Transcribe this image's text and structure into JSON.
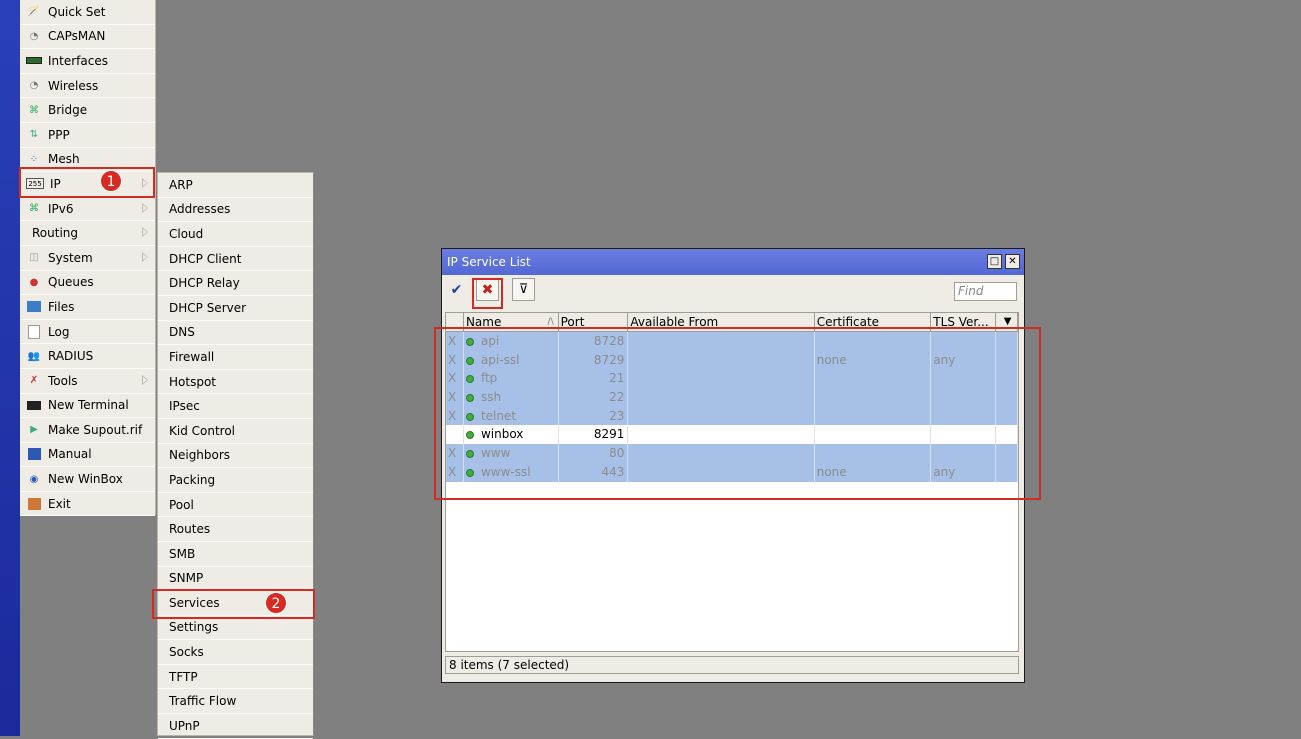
{
  "main_menu": [
    {
      "label": "Quick Set",
      "icon": "wand-icon",
      "submenu": false
    },
    {
      "label": "CAPsMAN",
      "icon": "antenna-icon",
      "submenu": false
    },
    {
      "label": "Interfaces",
      "icon": "interfaces-icon",
      "submenu": false
    },
    {
      "label": "Wireless",
      "icon": "wireless-icon",
      "submenu": false
    },
    {
      "label": "Bridge",
      "icon": "bridge-icon",
      "submenu": false
    },
    {
      "label": "PPP",
      "icon": "ppp-icon",
      "submenu": false
    },
    {
      "label": "Mesh",
      "icon": "mesh-icon",
      "submenu": false
    },
    {
      "label": "IP",
      "icon": "ip-icon",
      "submenu": true
    },
    {
      "label": "IPv6",
      "icon": "ipv6-icon",
      "submenu": true
    },
    {
      "label": "Routing",
      "icon": "",
      "submenu": true
    },
    {
      "label": "System",
      "icon": "system-icon",
      "submenu": true
    },
    {
      "label": "Queues",
      "icon": "queues-icon",
      "submenu": false
    },
    {
      "label": "Files",
      "icon": "folder-icon",
      "submenu": false
    },
    {
      "label": "Log",
      "icon": "log-icon",
      "submenu": false
    },
    {
      "label": "RADIUS",
      "icon": "radius-icon",
      "submenu": false
    },
    {
      "label": "Tools",
      "icon": "tools-icon",
      "submenu": true
    },
    {
      "label": "New Terminal",
      "icon": "terminal-icon",
      "submenu": false
    },
    {
      "label": "Make Supout.rif",
      "icon": "supout-icon",
      "submenu": false
    },
    {
      "label": "Manual",
      "icon": "manual-icon",
      "submenu": false
    },
    {
      "label": "New WinBox",
      "icon": "winbox-icon",
      "submenu": false
    },
    {
      "label": "Exit",
      "icon": "exit-icon",
      "submenu": false
    }
  ],
  "ip_submenu": [
    "ARP",
    "Addresses",
    "Cloud",
    "DHCP Client",
    "DHCP Relay",
    "DHCP Server",
    "DNS",
    "Firewall",
    "Hotspot",
    "IPsec",
    "Kid Control",
    "Neighbors",
    "Packing",
    "Pool",
    "Routes",
    "SMB",
    "SNMP",
    "Services",
    "Settings",
    "Socks",
    "TFTP",
    "Traffic Flow",
    "UPnP"
  ],
  "badges": {
    "one": "1",
    "two": "2"
  },
  "window": {
    "title": "IP Service List",
    "find_placeholder": "Find",
    "columns": [
      "Name",
      "Port",
      "Available From",
      "Certificate",
      "TLS Ver..."
    ],
    "rows": [
      {
        "flag": "X",
        "name": "api",
        "port": "8728",
        "available": "",
        "certificate": "",
        "tls": "",
        "disabled": true
      },
      {
        "flag": "X",
        "name": "api-ssl",
        "port": "8729",
        "available": "",
        "certificate": "none",
        "tls": "any",
        "disabled": true
      },
      {
        "flag": "X",
        "name": "ftp",
        "port": "21",
        "available": "",
        "certificate": "",
        "tls": "",
        "disabled": true
      },
      {
        "flag": "X",
        "name": "ssh",
        "port": "22",
        "available": "",
        "certificate": "",
        "tls": "",
        "disabled": true
      },
      {
        "flag": "X",
        "name": "telnet",
        "port": "23",
        "available": "",
        "certificate": "",
        "tls": "",
        "disabled": true
      },
      {
        "flag": "",
        "name": "winbox",
        "port": "8291",
        "available": "",
        "certificate": "",
        "tls": "",
        "disabled": false
      },
      {
        "flag": "X",
        "name": "www",
        "port": "80",
        "available": "",
        "certificate": "",
        "tls": "",
        "disabled": true
      },
      {
        "flag": "X",
        "name": "www-ssl",
        "port": "443",
        "available": "",
        "certificate": "none",
        "tls": "any",
        "disabled": true
      }
    ],
    "status": "8 items (7 selected)"
  },
  "colors": {
    "highlight": "#d02c26",
    "title_bar": "#5a6ed8",
    "selected_row": "#a7c0e8"
  }
}
